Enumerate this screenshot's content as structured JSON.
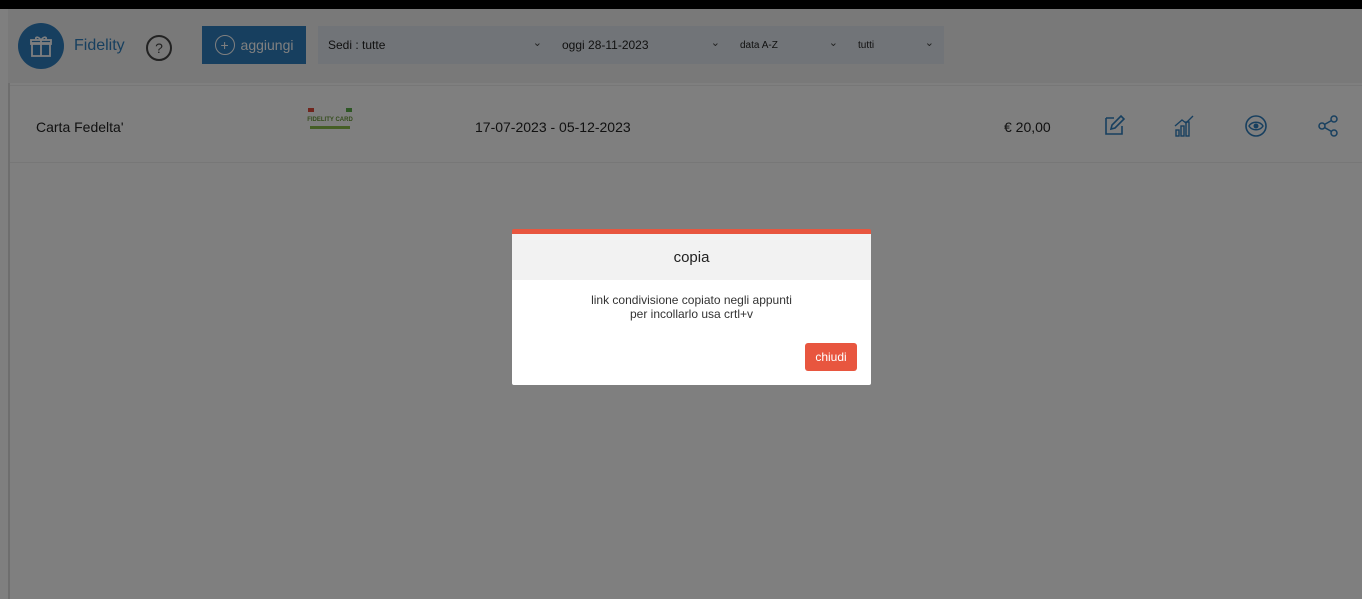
{
  "app": {
    "title": "Fidelity",
    "help_symbol": "?"
  },
  "toolbar": {
    "add_label": "aggiungi",
    "sedi": "Sedi : tutte",
    "date": "oggi 28-11-2023",
    "sort": "data A-Z",
    "filter": "tutti"
  },
  "rows": [
    {
      "name": "Carta Fedelta'",
      "dates": "17-07-2023 - 05-12-2023",
      "price": "€ 20,00",
      "card_text": "FIDELITY CARD"
    }
  ],
  "modal": {
    "title": "copia",
    "line1": "link condivisione copiato negli appunti",
    "line2": "per incollarlo usa crtl+v",
    "close_label": "chiudi"
  },
  "colors": {
    "accent": "#2f7fbf",
    "danger": "#e8563f"
  },
  "icons": [
    "gift-icon",
    "help-icon",
    "plus-circle-icon",
    "chevron-down-icon",
    "edit-icon",
    "stats-icon",
    "view-icon",
    "share-icon"
  ]
}
